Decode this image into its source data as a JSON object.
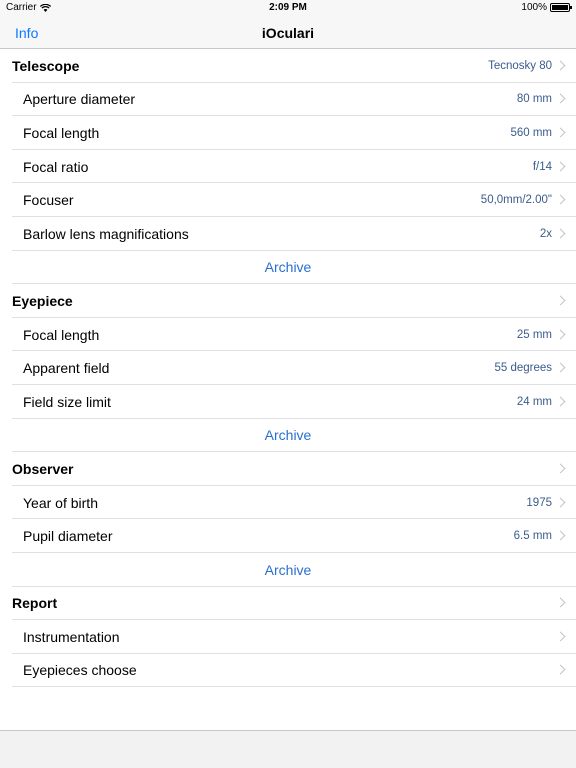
{
  "status": {
    "carrier": "Carrier",
    "time": "2:09 PM",
    "battery": "100%"
  },
  "nav": {
    "left": "Info",
    "title": "iOculari"
  },
  "telescope": {
    "header": "Telescope",
    "value": "Tecnosky 80",
    "items": [
      {
        "label": "Aperture diameter",
        "value": "80 mm"
      },
      {
        "label": "Focal length",
        "value": "560 mm"
      },
      {
        "label": "Focal ratio",
        "value": "f/14"
      },
      {
        "label": "Focuser",
        "value": "50,0mm/2.00\""
      },
      {
        "label": "Barlow lens magnifications",
        "value": "2x"
      }
    ],
    "archive": "Archive"
  },
  "eyepiece": {
    "header": "Eyepiece",
    "items": [
      {
        "label": "Focal length",
        "value": "25 mm"
      },
      {
        "label": "Apparent field",
        "value": "55 degrees"
      },
      {
        "label": "Field size limit",
        "value": "24 mm"
      }
    ],
    "archive": "Archive"
  },
  "observer": {
    "header": "Observer",
    "items": [
      {
        "label": "Year of birth",
        "value": "1975"
      },
      {
        "label": "Pupil diameter",
        "value": "6.5 mm"
      }
    ],
    "archive": "Archive"
  },
  "report": {
    "header": "Report",
    "items": [
      {
        "label": "Instrumentation"
      },
      {
        "label": "Eyepieces choose"
      }
    ]
  },
  "icons": {
    "wifi": "wifi-icon",
    "battery": "battery-icon",
    "chevron": "chevron-right-icon"
  },
  "colors": {
    "accent": "#0a7aff",
    "value": "#3a5c8c"
  }
}
